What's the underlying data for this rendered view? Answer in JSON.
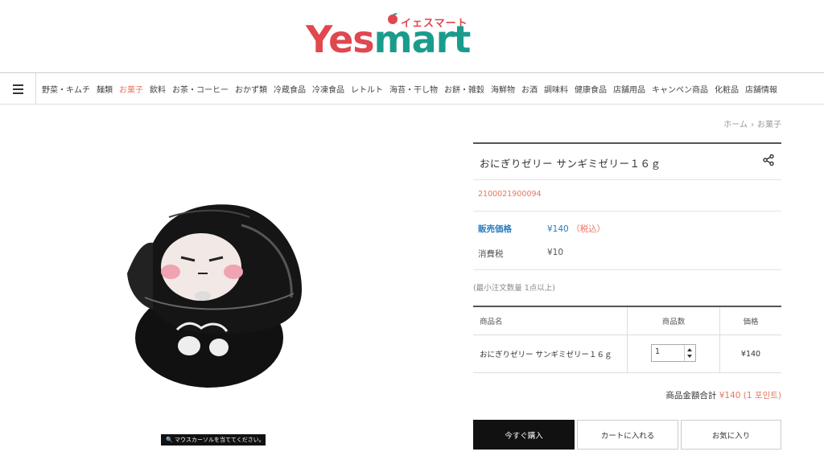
{
  "header": {
    "logo_text_yes": "Yes",
    "logo_text_mart": "mart",
    "logo_kana": "イェスマート",
    "colors": {
      "brand_red": "#e0474f",
      "brand_green": "#1a9c8c"
    }
  },
  "nav": {
    "menu_icon": "hamburger-icon",
    "items": [
      {
        "label": "野菜・キムチ"
      },
      {
        "label": "麺類"
      },
      {
        "label": "お菓子",
        "active": true
      },
      {
        "label": "飲料"
      },
      {
        "label": "お茶・コーヒー"
      },
      {
        "label": "おかず類"
      },
      {
        "label": "冷蔵食品"
      },
      {
        "label": "冷凍食品"
      },
      {
        "label": "レトルト"
      },
      {
        "label": "海苔・干し物"
      },
      {
        "label": "お餅・雑穀"
      },
      {
        "label": "海鮮物"
      },
      {
        "label": "お酒"
      },
      {
        "label": "調味料"
      },
      {
        "label": "健康食品"
      },
      {
        "label": "店舗用品"
      },
      {
        "label": "キャンペン商品"
      },
      {
        "label": "化粧品"
      },
      {
        "label": "店舗情報"
      }
    ],
    "active_color": "#e87560"
  },
  "breadcrumb": {
    "home": "ホーム",
    "current": "お菓子"
  },
  "image": {
    "hint": "マウスカーソルを当ててください。"
  },
  "product": {
    "title": "おにぎりゼリー サンギミゼリー１６ｇ",
    "code": "2100021900094",
    "price_label": "販売価格",
    "price": "¥140",
    "price_note": "（税込）",
    "tax_label": "消費税",
    "tax": "¥10",
    "min_order": "(最小注文数量 1点以上)"
  },
  "table": {
    "headers": [
      "商品名",
      "商品数",
      "価格"
    ],
    "rows": [
      {
        "name": "おにぎりゼリー サンギミゼリー１６ｇ",
        "qty": "1",
        "price": "¥140"
      }
    ]
  },
  "total": {
    "label": "商品金額合計",
    "amount": "¥140 (1 포인트)"
  },
  "buttons": {
    "buy": "今すぐ購入",
    "cart": "カートに入れる",
    "fav": "お気に入り"
  }
}
